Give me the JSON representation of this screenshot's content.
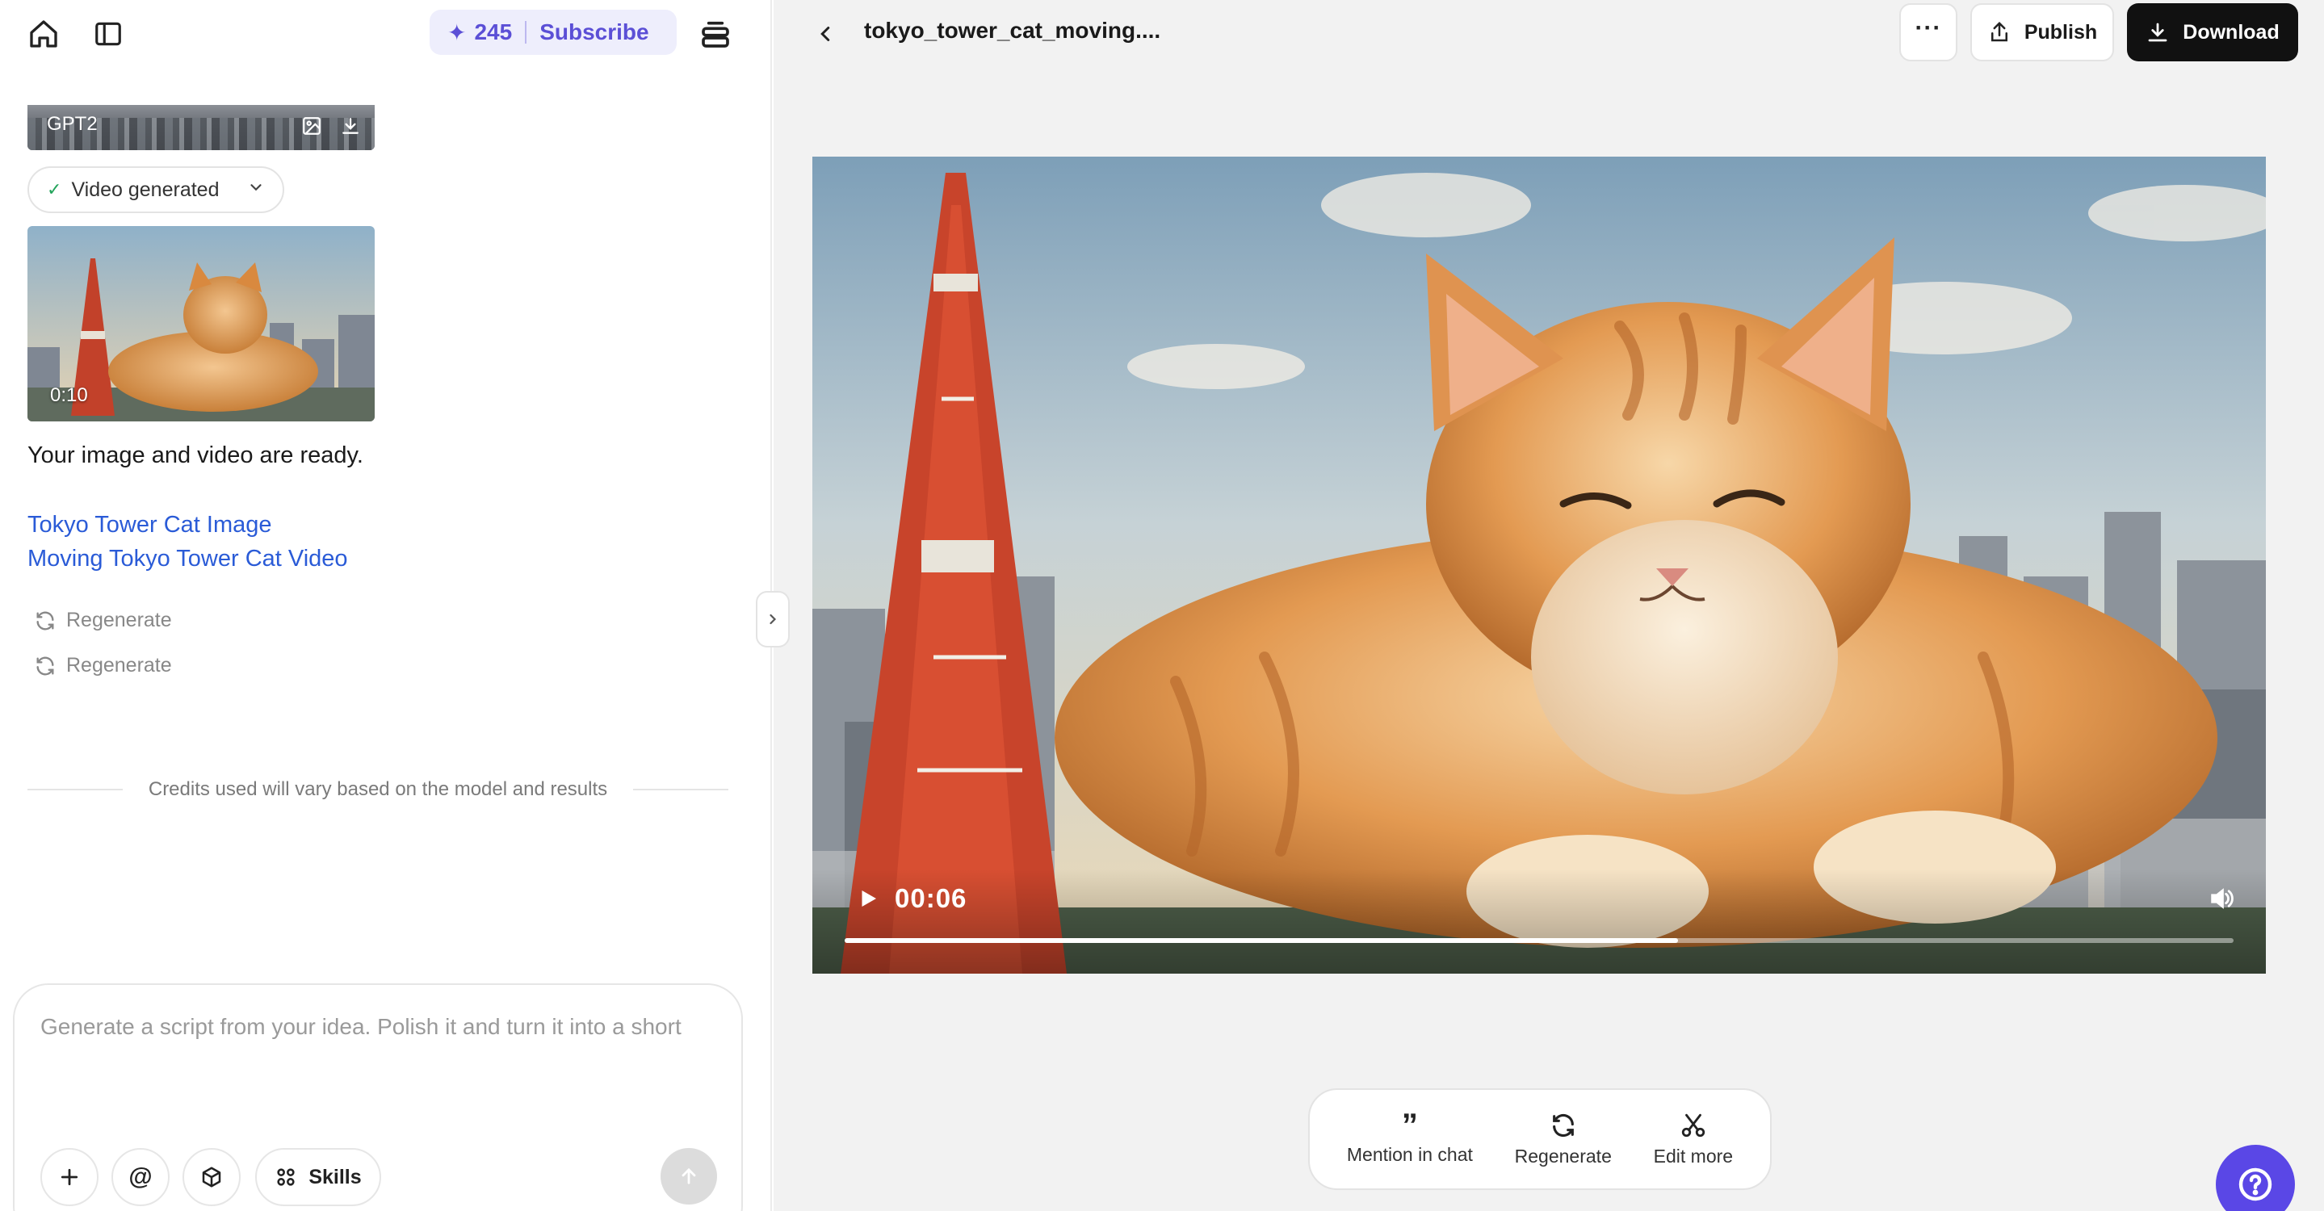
{
  "header_left": {
    "credits": "245",
    "subscribe_label": "Subscribe"
  },
  "chat": {
    "model_label": "GPT2",
    "status_label": "Video generated",
    "video_duration": "0:10",
    "ready_message": "Your image and video are ready.",
    "links": [
      "Tokyo Tower Cat Image",
      "Moving Tokyo Tower Cat Video"
    ],
    "regenerate_label": "Regenerate",
    "credits_note": "Credits used will vary based on the model and results"
  },
  "composer": {
    "placeholder": "Generate a script from your idea. Polish it and turn it into a short",
    "skills_label": "Skills"
  },
  "viewer": {
    "file_title": "tokyo_tower_cat_moving....",
    "publish_label": "Publish",
    "download_label": "Download",
    "current_time": "00:06",
    "progress_fraction": 0.6
  },
  "action_bar": {
    "mention_label": "Mention in chat",
    "regenerate_label": "Regenerate",
    "edit_label": "Edit more"
  },
  "colors": {
    "accent": "#5b4fd6",
    "link": "#2a5bd7",
    "help_button": "#5a47e6"
  }
}
